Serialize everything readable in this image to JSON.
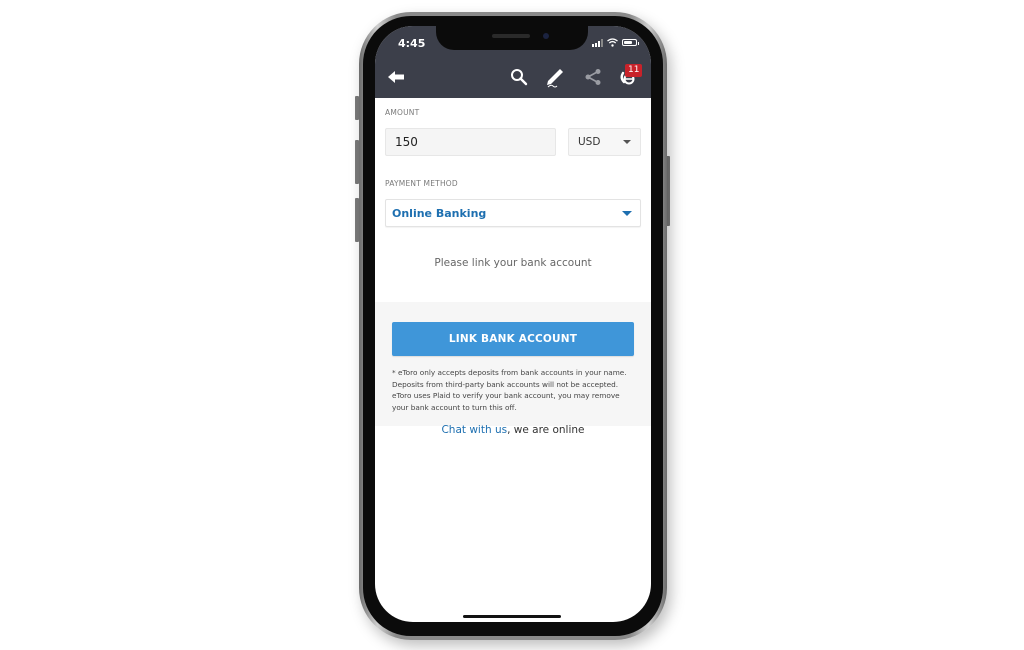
{
  "status_bar": {
    "time": "4:45",
    "signal_bars": 4,
    "wifi_icon": "wifi-icon",
    "battery_level_percent": 70
  },
  "nav": {
    "icons": [
      "back-arrow-icon",
      "search-icon",
      "edit-pencil-icon",
      "share-icon",
      "etoro-logo-icon"
    ],
    "notification_badge": "11"
  },
  "form": {
    "amount_label": "AMOUNT",
    "amount_value": "150",
    "currency_value": "USD",
    "payment_method_label": "PAYMENT METHOD",
    "payment_method_value": "Online Banking"
  },
  "prompt": "Please link your bank account",
  "link_button_label": "LINK BANK ACCOUNT",
  "disclaimer": "* eToro only accepts deposits from bank accounts in your name. Deposits from third-party bank accounts will not be accepted. eToro uses Plaid to verify your bank account, you may remove your bank account to turn this off.",
  "chat": {
    "link_text": "Chat with us",
    "suffix": ", we are online"
  },
  "colors": {
    "header_bg": "#3c3f4a",
    "accent_blue": "#1d6fb0",
    "button_blue": "#3f96d9",
    "badge_red": "#c8222a"
  }
}
